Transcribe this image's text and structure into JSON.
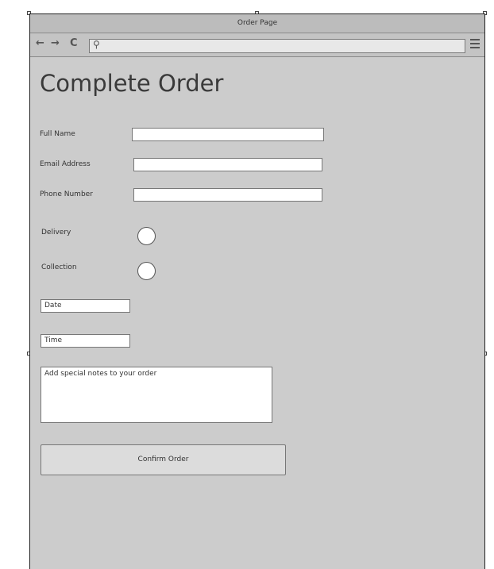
{
  "window": {
    "title": "Order Page"
  },
  "navbar": {
    "back_icon": "←",
    "forward_icon": "→",
    "reload_icon": "C",
    "search_icon": "⚲"
  },
  "page": {
    "heading": "Complete Order"
  },
  "form": {
    "full_name_label": "Full Name",
    "email_label": "Email Address",
    "phone_label": "Phone Number",
    "delivery_label": "Delivery",
    "collection_label": "Collection",
    "date_placeholder": "Date",
    "time_placeholder": "Time",
    "notes_placeholder": "Add special notes to your order",
    "confirm_label": "Confirm Order"
  }
}
